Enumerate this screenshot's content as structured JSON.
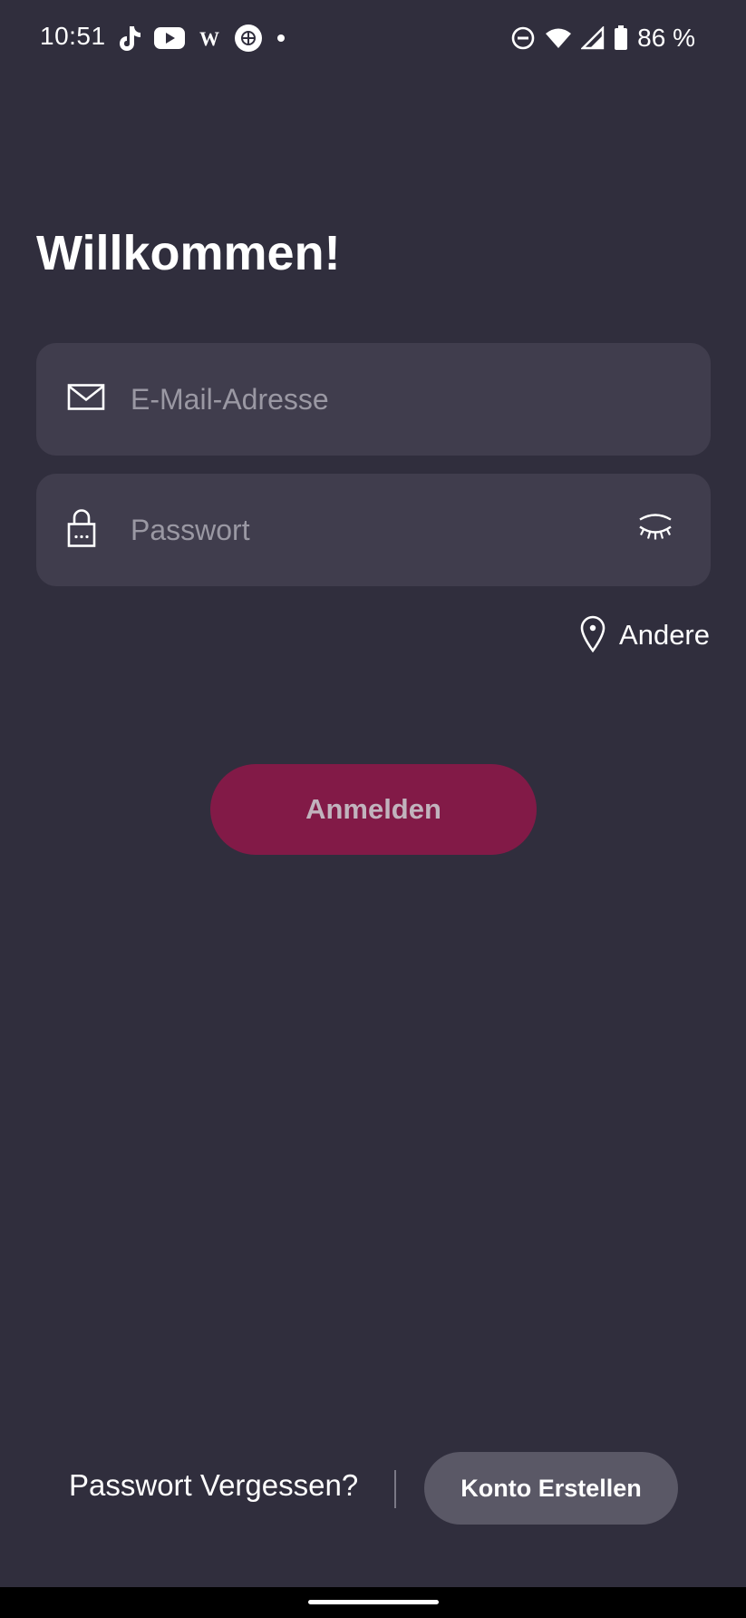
{
  "status_bar": {
    "time": "10:51",
    "battery_text": "86 %",
    "notification_icons": [
      "tiktok-icon",
      "youtube-icon",
      "wikipedia-icon",
      "app-icon",
      "dot-icon"
    ],
    "system_icons": [
      "do-not-disturb-icon",
      "wifi-icon",
      "cell-signal-icon",
      "battery-icon"
    ]
  },
  "login": {
    "title": "Willkommen!",
    "email_placeholder": "E-Mail-Adresse",
    "email_value": "",
    "password_placeholder": "Passwort",
    "password_value": "",
    "location_label": "Andere",
    "login_button": "Anmelden"
  },
  "footer": {
    "forgot_password": "Passwort Vergessen?",
    "create_account": "Konto Erstellen"
  },
  "colors": {
    "background": "#302e3d",
    "field_background": "#403d4d",
    "primary_button": "#821a47",
    "secondary_button": "#5a5866"
  }
}
